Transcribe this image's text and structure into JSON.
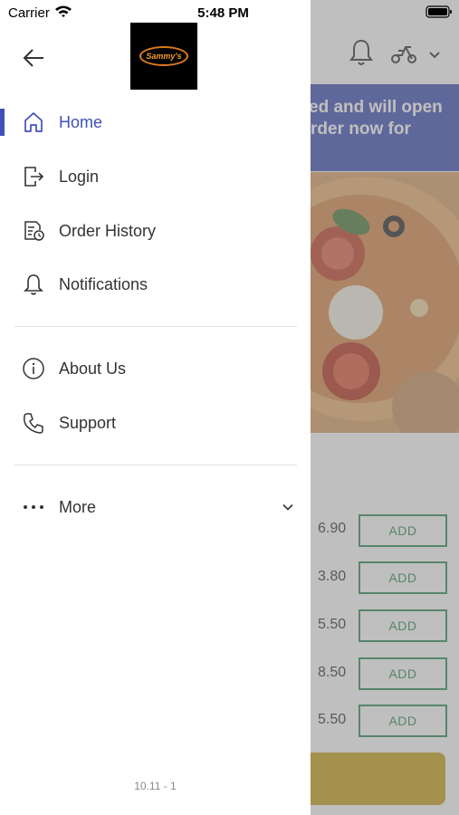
{
  "status_bar": {
    "carrier": "Carrier",
    "time": "5:48 PM"
  },
  "drawer": {
    "logo_text": "Sammy's",
    "items": [
      {
        "label": "Home",
        "icon": "home-icon",
        "active": true
      },
      {
        "label": "Login",
        "icon": "login-icon",
        "active": false
      },
      {
        "label": "Order History",
        "icon": "order-history-icon",
        "active": false
      },
      {
        "label": "Notifications",
        "icon": "bell-icon",
        "active": false
      },
      {
        "label": "About Us",
        "icon": "info-icon",
        "active": false
      },
      {
        "label": "Support",
        "icon": "phone-icon",
        "active": false
      },
      {
        "label": "More",
        "icon": "more-dots-icon",
        "active": false
      }
    ],
    "version": "10.11 - 1"
  },
  "background": {
    "banner_line1": "ed and will open",
    "banner_line2": "rder now for",
    "prices": [
      "6.90",
      "3.80",
      "5.50",
      "8.50",
      "5.50"
    ],
    "add_label": "ADD"
  },
  "colors": {
    "accent": "#3f51b5",
    "add_green": "#2e8b57",
    "cta_yellow": "#c9a21a"
  }
}
